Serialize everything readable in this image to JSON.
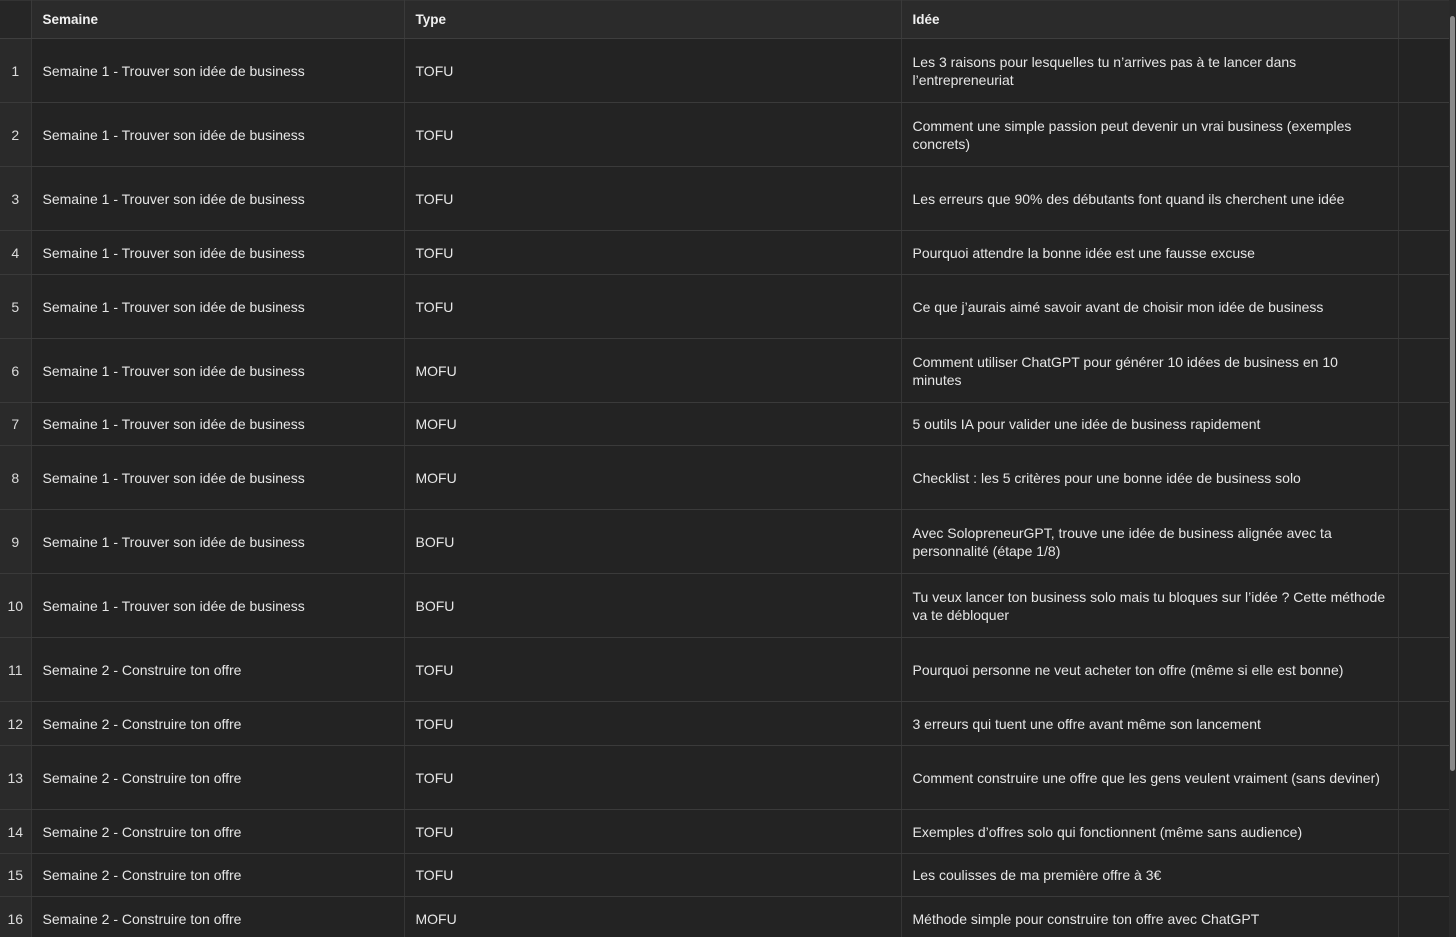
{
  "columns": {
    "semaine": "Semaine",
    "type": "Type",
    "idee": "Idée"
  },
  "rows": [
    {
      "n": "1",
      "semaine": "Semaine 1 - Trouver son idée de business",
      "type": "TOFU",
      "idee": "Les 3 raisons pour lesquelles tu n’arrives pas à te lancer dans l’entrepreneuriat"
    },
    {
      "n": "2",
      "semaine": "Semaine 1 - Trouver son idée de business",
      "type": "TOFU",
      "idee": "Comment une simple passion peut devenir un vrai business (exemples concrets)"
    },
    {
      "n": "3",
      "semaine": "Semaine 1 - Trouver son idée de business",
      "type": "TOFU",
      "idee": "Les erreurs que 90% des débutants font quand ils cherchent une idée"
    },
    {
      "n": "4",
      "semaine": "Semaine 1 - Trouver son idée de business",
      "type": "TOFU",
      "idee": "Pourquoi attendre la bonne idée est une fausse excuse"
    },
    {
      "n": "5",
      "semaine": "Semaine 1 - Trouver son idée de business",
      "type": "TOFU",
      "idee": "Ce que j’aurais aimé savoir avant de choisir mon idée de business"
    },
    {
      "n": "6",
      "semaine": "Semaine 1 - Trouver son idée de business",
      "type": "MOFU",
      "idee": "Comment utiliser ChatGPT pour générer 10 idées de business en 10 minutes"
    },
    {
      "n": "7",
      "semaine": "Semaine 1 - Trouver son idée de business",
      "type": "MOFU",
      "idee": "5 outils IA pour valider une idée de business rapidement"
    },
    {
      "n": "8",
      "semaine": "Semaine 1 - Trouver son idée de business",
      "type": "MOFU",
      "idee": "Checklist : les 5 critères pour une bonne idée de business solo"
    },
    {
      "n": "9",
      "semaine": "Semaine 1 - Trouver son idée de business",
      "type": "BOFU",
      "idee": "Avec SolopreneurGPT, trouve une idée de business alignée avec ta personnalité (étape 1/8)"
    },
    {
      "n": "10",
      "semaine": "Semaine 1 - Trouver son idée de business",
      "type": "BOFU",
      "idee": "Tu veux lancer ton business solo mais tu bloques sur l’idée ? Cette méthode va te débloquer"
    },
    {
      "n": "11",
      "semaine": "Semaine 2 - Construire ton offre",
      "type": "TOFU",
      "idee": "Pourquoi personne ne veut acheter ton offre (même si elle est bonne)"
    },
    {
      "n": "12",
      "semaine": "Semaine 2 - Construire ton offre",
      "type": "TOFU",
      "idee": "3 erreurs qui tuent une offre avant même son lancement"
    },
    {
      "n": "13",
      "semaine": "Semaine 2 - Construire ton offre",
      "type": "TOFU",
      "idee": "Comment construire une offre que les gens veulent vraiment (sans deviner)"
    },
    {
      "n": "14",
      "semaine": "Semaine 2 - Construire ton offre",
      "type": "TOFU",
      "idee": "Exemples d’offres solo qui fonctionnent (même sans audience)"
    },
    {
      "n": "15",
      "semaine": "Semaine 2 - Construire ton offre",
      "type": "TOFU",
      "idee": "Les coulisses de ma première offre à 3€"
    },
    {
      "n": "16",
      "semaine": "Semaine 2 - Construire ton offre",
      "type": "MOFU",
      "idee": "Méthode simple pour construire ton offre avec ChatGPT"
    }
  ]
}
